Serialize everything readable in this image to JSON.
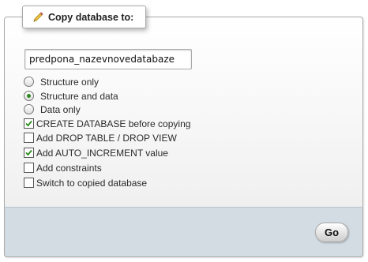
{
  "dialog": {
    "title": "Copy database to:",
    "title_icon": "pencil-icon",
    "new_name_value": "predpona_nazevnovedatabaze"
  },
  "copy_mode": {
    "options": [
      {
        "label": "Structure only",
        "checked": false
      },
      {
        "label": "Structure and data",
        "checked": true
      },
      {
        "label": "Data only",
        "checked": false
      }
    ]
  },
  "checkboxes": [
    {
      "label": "CREATE DATABASE before copying",
      "checked": true
    },
    {
      "label": "Add DROP TABLE / DROP VIEW",
      "checked": false
    },
    {
      "label": "Add AUTO_INCREMENT value",
      "checked": true
    },
    {
      "label": "Add constraints",
      "checked": false
    },
    {
      "label": "Switch to copied database",
      "checked": false
    }
  ],
  "footer": {
    "go_label": "Go"
  },
  "colors": {
    "footer_bg": "#d3dce3",
    "check_mark": "#2c8a1e",
    "border": "#aaaaaa"
  }
}
